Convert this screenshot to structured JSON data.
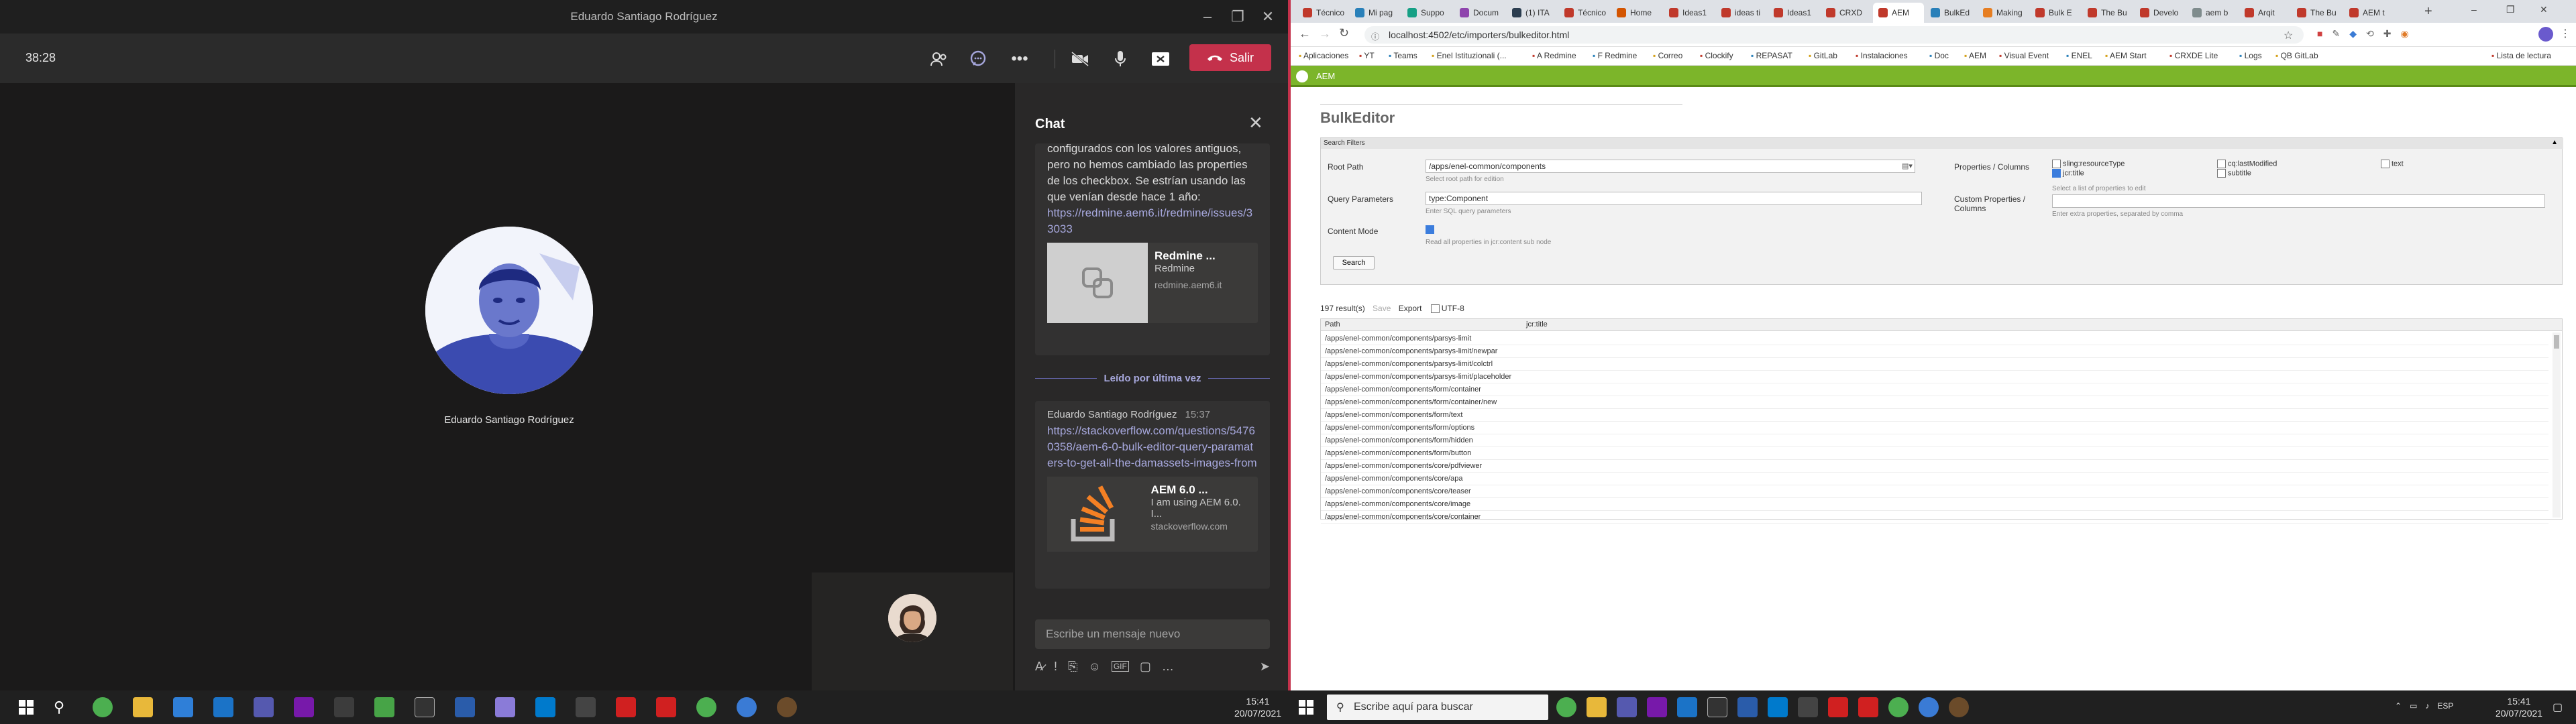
{
  "teams": {
    "window_title": "Eduardo Santiago Rodríguez",
    "timer": "38:28",
    "leave_label": "Salir",
    "participant_name": "Eduardo Santiago Rodríguez",
    "chat": {
      "title": "Chat",
      "msg1_text": "configurados con los valores antiguos, pero no hemos cambiado las properties de los checkbox. Se estrían usando las que venían desde hace 1 año:",
      "msg1_link": "https://redmine.aem6.it/redmine/issues/33033",
      "card1": {
        "title": "Redmine ...",
        "subtitle": "Redmine",
        "url": "redmine.aem6.it"
      },
      "read_label": "Leído por última vez",
      "msg2_author": "Eduardo Santiago Rodríguez",
      "msg2_time": "15:37",
      "msg2_link": "https://stackoverflow.com/questions/54760358/aem-6-0-bulk-editor-query-paramaters-to-get-all-the-damassets-images-from",
      "card2": {
        "title": "AEM 6.0 ...",
        "subtitle": "I am using AEM 6.0. I...",
        "url": "stackoverflow.com"
      },
      "compose_placeholder": "Escribe un mensaje nuevo"
    }
  },
  "taskbar_left": {
    "time": "15:41",
    "date": "20/07/2021"
  },
  "taskbar_right": {
    "search_placeholder": "Escribe aquí para buscar",
    "time": "15:41",
    "date": "20/07/2021",
    "lang": "ESP"
  },
  "browser": {
    "tabs": [
      "Técnico",
      "Mi pag",
      "Suppo",
      "Docum",
      "(1) ITA",
      "Técnico",
      "Home",
      "Ideas1",
      "ideas ti",
      "Ideas1",
      "CRXD",
      "AEM",
      "BulkEd",
      "Making",
      "Bulk E",
      "The Bu",
      "Develo",
      "aem b",
      "Arqit",
      "The Bu",
      "AEM t"
    ],
    "url": "localhost:4502/etc/importers/bulkeditor.html",
    "bookmarks": [
      "Aplicaciones",
      "YT",
      "Teams",
      "Enel Istituzionali (...",
      "A Redmine",
      "F Redmine",
      "Correo",
      "Clockify",
      "REPASAT",
      "GitLab",
      "Instalaciones",
      "Doc",
      "AEM",
      "Visual Event",
      "ENEL",
      "AEM Start",
      "CRXDE Lite",
      "Logs",
      "QB GitLab",
      "Lista de lectura"
    ]
  },
  "aem": {
    "top_title": "AEM",
    "page_title": "BulkEditor",
    "filters_title": "Search Filters",
    "root_path_label": "Root Path",
    "root_path_value": "/apps/enel-common/components",
    "root_path_hint": "Select root path for edition",
    "query_label": "Query Parameters",
    "query_value": "type:Component",
    "query_hint": "Enter SQL query parameters",
    "content_mode_label": "Content Mode",
    "content_mode_hint": "Read all properties in jcr:content sub node",
    "props_label": "Properties / Columns",
    "props": [
      {
        "label": "sling:resourceType",
        "on": false
      },
      {
        "label": "cq:lastModified",
        "on": false
      },
      {
        "label": "text",
        "on": false
      },
      {
        "label": "jcr:title",
        "on": true
      },
      {
        "label": "subtitle",
        "on": false
      }
    ],
    "props_hint": "Select a list of properties to edit",
    "custom_label": "Custom Properties / Columns",
    "custom_hint": "Enter extra properties, separated by comma",
    "search_btn": "Search",
    "results": "197 result(s)",
    "save_btn": "Save",
    "export_btn": "Export",
    "utf8_label": "UTF-8",
    "col_path": "Path",
    "col_title": "jcr:title",
    "rows": [
      "/apps/enel-common/components/parsys-limit",
      "/apps/enel-common/components/parsys-limit/newpar",
      "/apps/enel-common/components/parsys-limit/colctrl",
      "/apps/enel-common/components/parsys-limit/placeholder",
      "/apps/enel-common/components/form/container",
      "/apps/enel-common/components/form/container/new",
      "/apps/enel-common/components/form/text",
      "/apps/enel-common/components/form/options",
      "/apps/enel-common/components/form/hidden",
      "/apps/enel-common/components/form/button",
      "/apps/enel-common/components/core/pdfviewer",
      "/apps/enel-common/components/core/apa",
      "/apps/enel-common/components/core/teaser",
      "/apps/enel-common/components/core/image",
      "/apps/enel-common/components/core/container"
    ]
  },
  "colors": {
    "leave": "#c4314b",
    "aem_green": "#7cb52a",
    "link": "#a6a7dc"
  }
}
